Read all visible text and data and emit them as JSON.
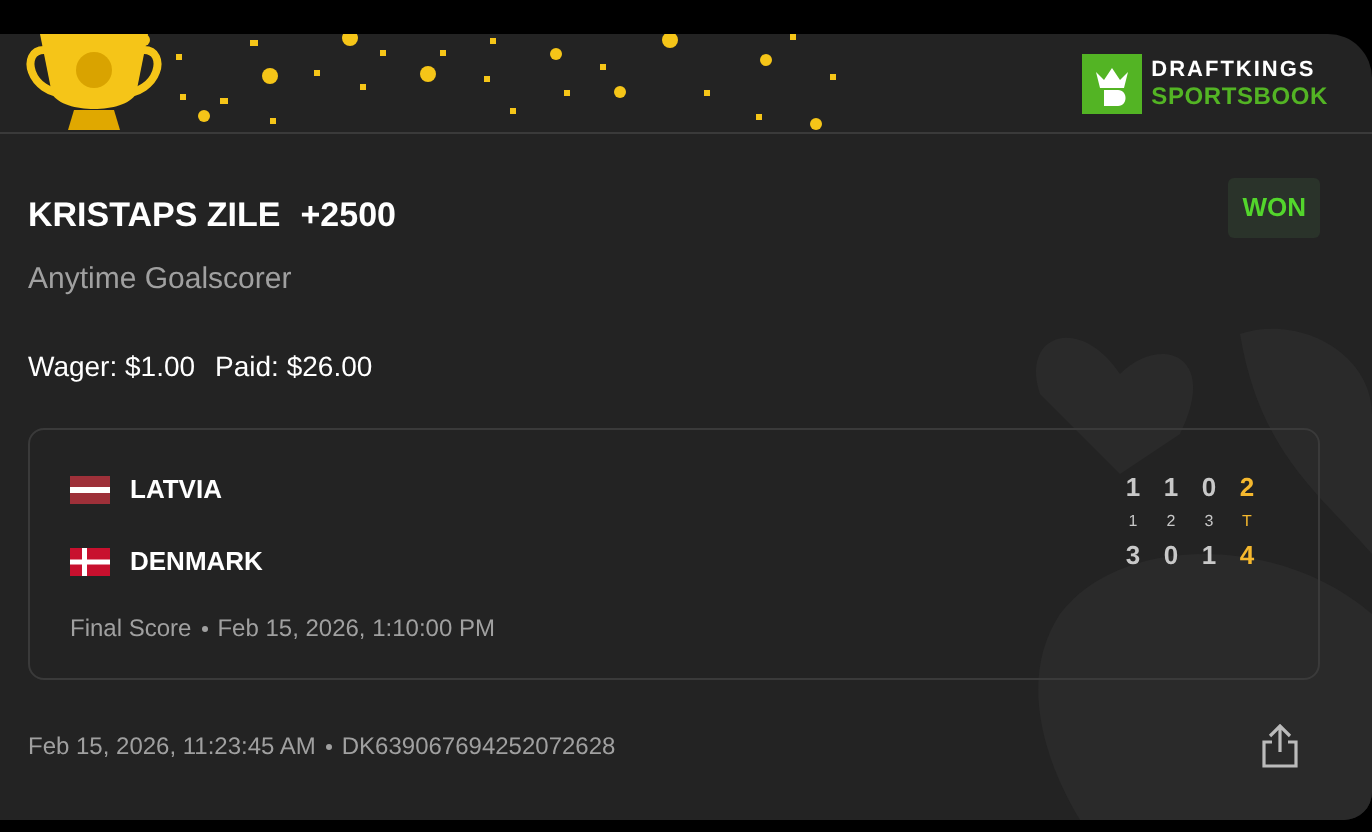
{
  "header": {
    "logo": {
      "line_1": "DRAFTKINGS",
      "line_2": "SPORTSBOOK"
    }
  },
  "bet": {
    "selection": "KRISTAPS ZILE",
    "odds": "+2500",
    "status": "WON",
    "market": "Anytime Goalscorer",
    "wager": "Wager: $1.00",
    "paid": "Paid: $26.00"
  },
  "event": {
    "teams": [
      {
        "name": "LATVIA",
        "kind": "striped",
        "scores": [
          "1",
          "1",
          "0"
        ],
        "total": "2"
      },
      {
        "name": "DENMARK",
        "kind": "cross",
        "scores": [
          "3",
          "0",
          "1"
        ],
        "total": "4"
      }
    ],
    "periods": [
      "1",
      "2",
      "3",
      "T"
    ],
    "status": "Final Score",
    "time": "Feb 15, 2026, 1:10:00 PM"
  },
  "footer": {
    "placed": "Feb 15, 2026, 11:23:45 AM",
    "bet_id": "DK639067694252072628"
  }
}
